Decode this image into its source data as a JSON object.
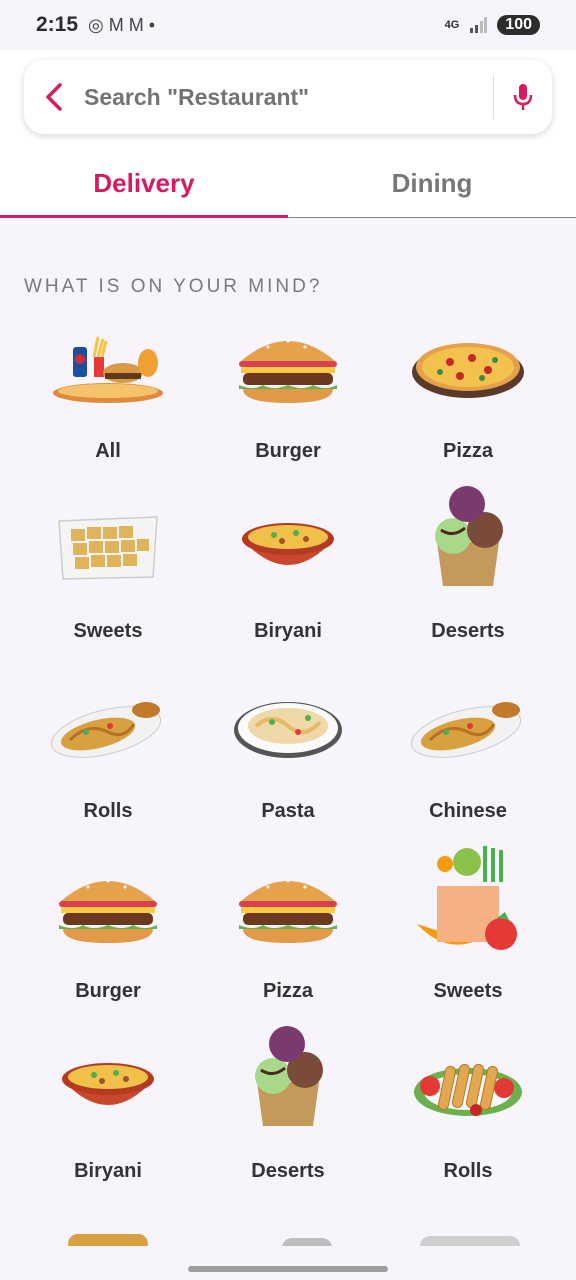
{
  "status_bar": {
    "time": "2:15",
    "notif_icons": "◎ M M •",
    "network": "4G",
    "battery": "100"
  },
  "search": {
    "placeholder": "Search \"Restaurant\""
  },
  "tabs": [
    {
      "label": "Delivery"
    },
    {
      "label": "Dining"
    }
  ],
  "section_title": "WHAT IS ON YOUR MIND?",
  "categories": [
    {
      "label": "All",
      "icon": "mixed-fast-food-icon"
    },
    {
      "label": "Burger",
      "icon": "burger-icon"
    },
    {
      "label": "Pizza",
      "icon": "pizza-icon"
    },
    {
      "label": "Sweets",
      "icon": "sweets-icon"
    },
    {
      "label": "Biryani",
      "icon": "biryani-icon"
    },
    {
      "label": "Deserts",
      "icon": "ice-cream-icon"
    },
    {
      "label": "Rolls",
      "icon": "noodles-icon"
    },
    {
      "label": "Pasta",
      "icon": "pasta-icon"
    },
    {
      "label": "Chinese",
      "icon": "noodles-icon"
    },
    {
      "label": "Burger",
      "icon": "burger-icon"
    },
    {
      "label": "Pizza",
      "icon": "burger-icon"
    },
    {
      "label": "Sweets",
      "icon": "grocery-bag-icon"
    },
    {
      "label": "Biryani",
      "icon": "biryani-icon"
    },
    {
      "label": "Deserts",
      "icon": "ice-cream-icon"
    },
    {
      "label": "Rolls",
      "icon": "spring-rolls-icon"
    }
  ],
  "colors": {
    "accent": "#d81b60",
    "background": "#f7f4fb"
  }
}
